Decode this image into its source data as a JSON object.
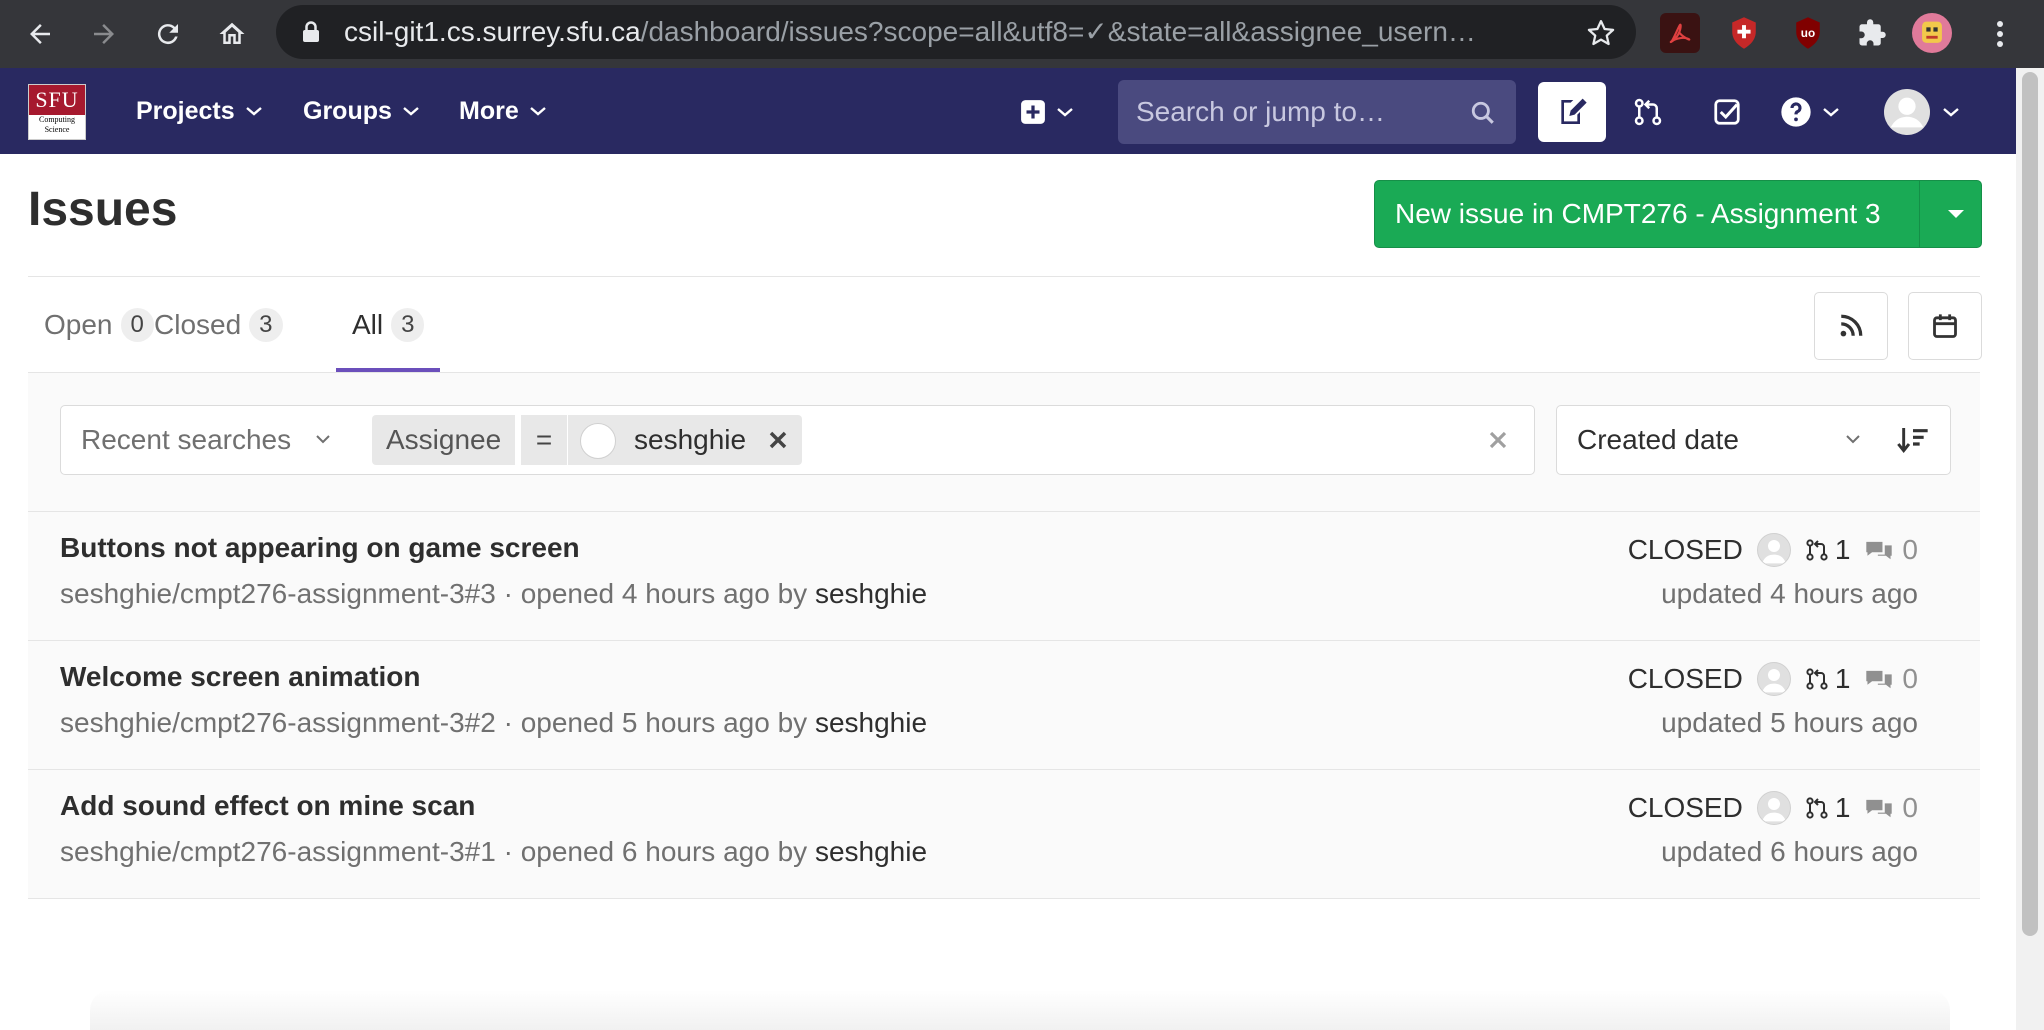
{
  "browser": {
    "url_host": "csil-git1.cs.surrey.sfu.ca",
    "url_path": "/dashboard/issues?scope=all&utf8=✓&state=all&assignee_usern…"
  },
  "nav": {
    "logo_text": "SFU",
    "logo_subtext": "Computing Science",
    "projects_label": "Projects",
    "groups_label": "Groups",
    "more_label": "More",
    "search_placeholder": "Search or jump to…"
  },
  "page": {
    "title": "Issues",
    "new_issue_label": "New issue in CMPT276 - Assignment 3"
  },
  "tabs": [
    {
      "label": "Open",
      "count": "0"
    },
    {
      "label": "Closed",
      "count": "3"
    },
    {
      "label": "All",
      "count": "3"
    }
  ],
  "filter": {
    "recent_searches_label": "Recent searches",
    "token_name": "Assignee",
    "token_operator": "=",
    "token_value": "seshghie",
    "sort_label": "Created date"
  },
  "issues": [
    {
      "title": "Buttons not appearing on game screen",
      "reference": "seshghie/cmpt276-assignment-3#3",
      "opened": " · opened 4 hours ago by ",
      "author": "seshghie",
      "state": "CLOSED",
      "merge_requests": "1",
      "comments": "0",
      "updated": "updated 4 hours ago"
    },
    {
      "title": "Welcome screen animation",
      "reference": "seshghie/cmpt276-assignment-3#2",
      "opened": " · opened 5 hours ago by ",
      "author": "seshghie",
      "state": "CLOSED",
      "merge_requests": "1",
      "comments": "0",
      "updated": "updated 5 hours ago"
    },
    {
      "title": "Add sound effect on mine scan",
      "reference": "seshghie/cmpt276-assignment-3#1",
      "opened": " · opened 6 hours ago by ",
      "author": "seshghie",
      "state": "CLOSED",
      "merge_requests": "1",
      "comments": "0",
      "updated": "updated 6 hours ago"
    }
  ],
  "colors": {
    "nav_bg": "#292961",
    "accent_green": "#1aaa55",
    "tab_underline": "#6b4fbb"
  }
}
